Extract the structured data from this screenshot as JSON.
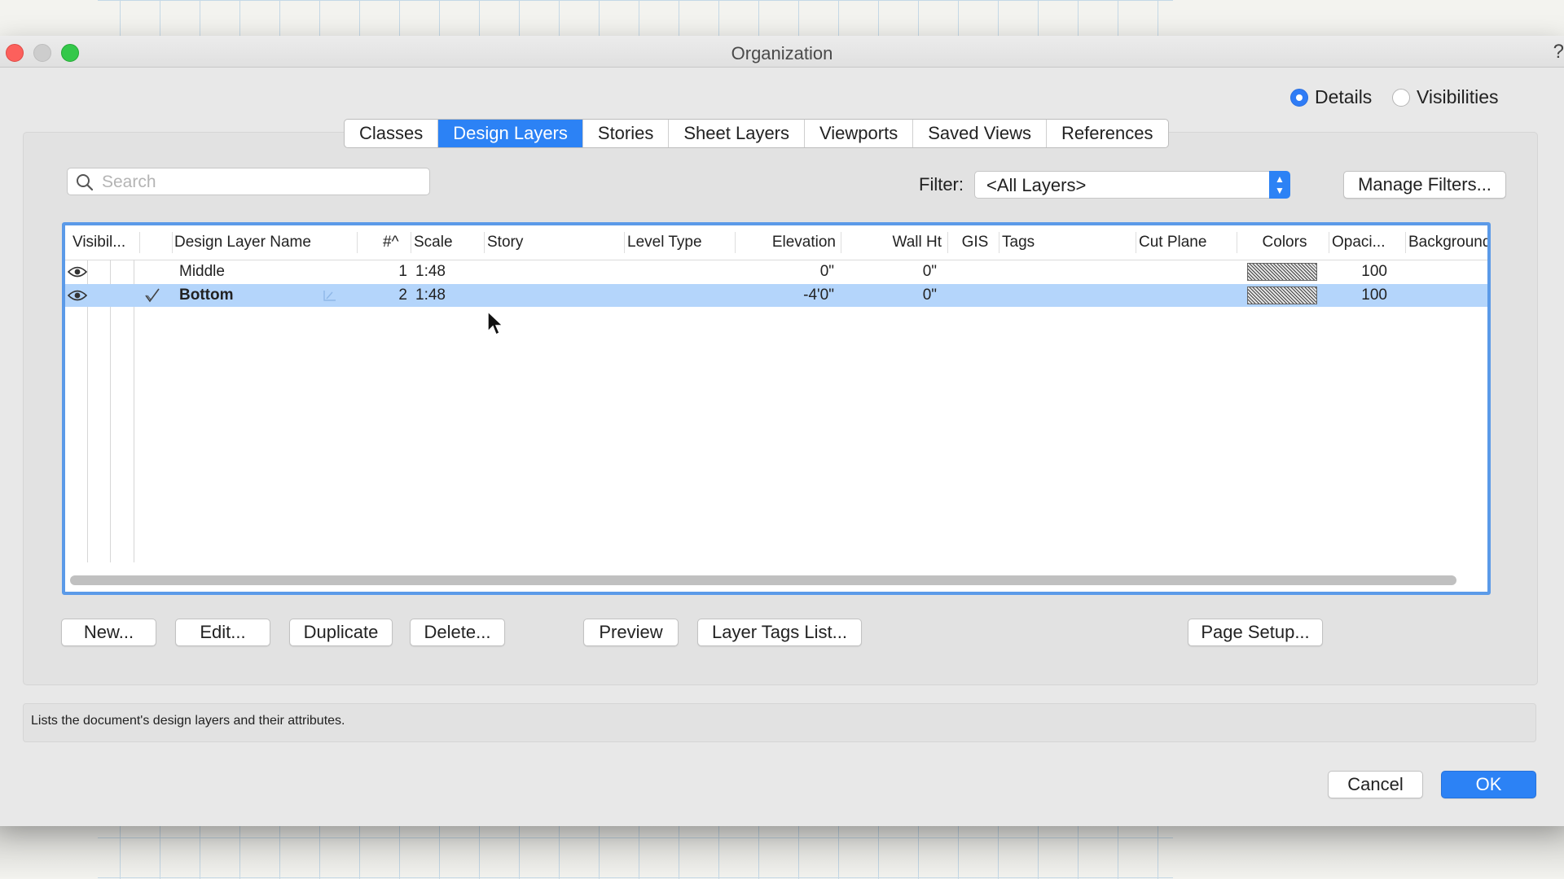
{
  "window": {
    "title": "Organization",
    "help": "?"
  },
  "view_mode": {
    "details_label": "Details",
    "visibilities_label": "Visibilities",
    "selected": "Details"
  },
  "tabs": [
    {
      "label": "Classes",
      "active": false
    },
    {
      "label": "Design Layers",
      "active": true
    },
    {
      "label": "Stories",
      "active": false
    },
    {
      "label": "Sheet Layers",
      "active": false
    },
    {
      "label": "Viewports",
      "active": false
    },
    {
      "label": "Saved Views",
      "active": false
    },
    {
      "label": "References",
      "active": false
    }
  ],
  "search": {
    "placeholder": "Search",
    "value": ""
  },
  "filter": {
    "label": "Filter:",
    "value": "<All Layers>"
  },
  "manage_filters_label": "Manage Filters...",
  "table": {
    "columns": [
      "Visibil...",
      "Design Layer Name",
      "#^",
      "Scale",
      "Story",
      "Level Type",
      "Elevation",
      "Wall Ht",
      "GIS",
      "Tags",
      "Cut Plane",
      "Colors",
      "Opaci...",
      "Background"
    ],
    "rows": [
      {
        "name": "Middle",
        "num": "1",
        "scale": "1:48",
        "story": "",
        "level_type": "",
        "elevation": "0\"",
        "wall_ht": "0\"",
        "gis": "",
        "tags": "",
        "cut_plane": "",
        "opacity": "100",
        "selected": false,
        "active": false
      },
      {
        "name": "Bottom",
        "num": "2",
        "scale": "1:48",
        "story": "",
        "level_type": "",
        "elevation": "-4'0\"",
        "wall_ht": "0\"",
        "gis": "",
        "tags": "",
        "cut_plane": "",
        "opacity": "100",
        "selected": true,
        "active": true
      }
    ]
  },
  "buttons": {
    "new": "New...",
    "edit": "Edit...",
    "duplicate": "Duplicate",
    "delete": "Delete...",
    "preview": "Preview",
    "layer_tags": "Layer Tags List...",
    "page_setup": "Page Setup...",
    "cancel": "Cancel",
    "ok": "OK"
  },
  "status_text": "Lists the document's design layers and their attributes.",
  "colors": {
    "accent": "#2c82f5",
    "selection": "#b4d5fb",
    "table_border": "#5b9ae8"
  }
}
